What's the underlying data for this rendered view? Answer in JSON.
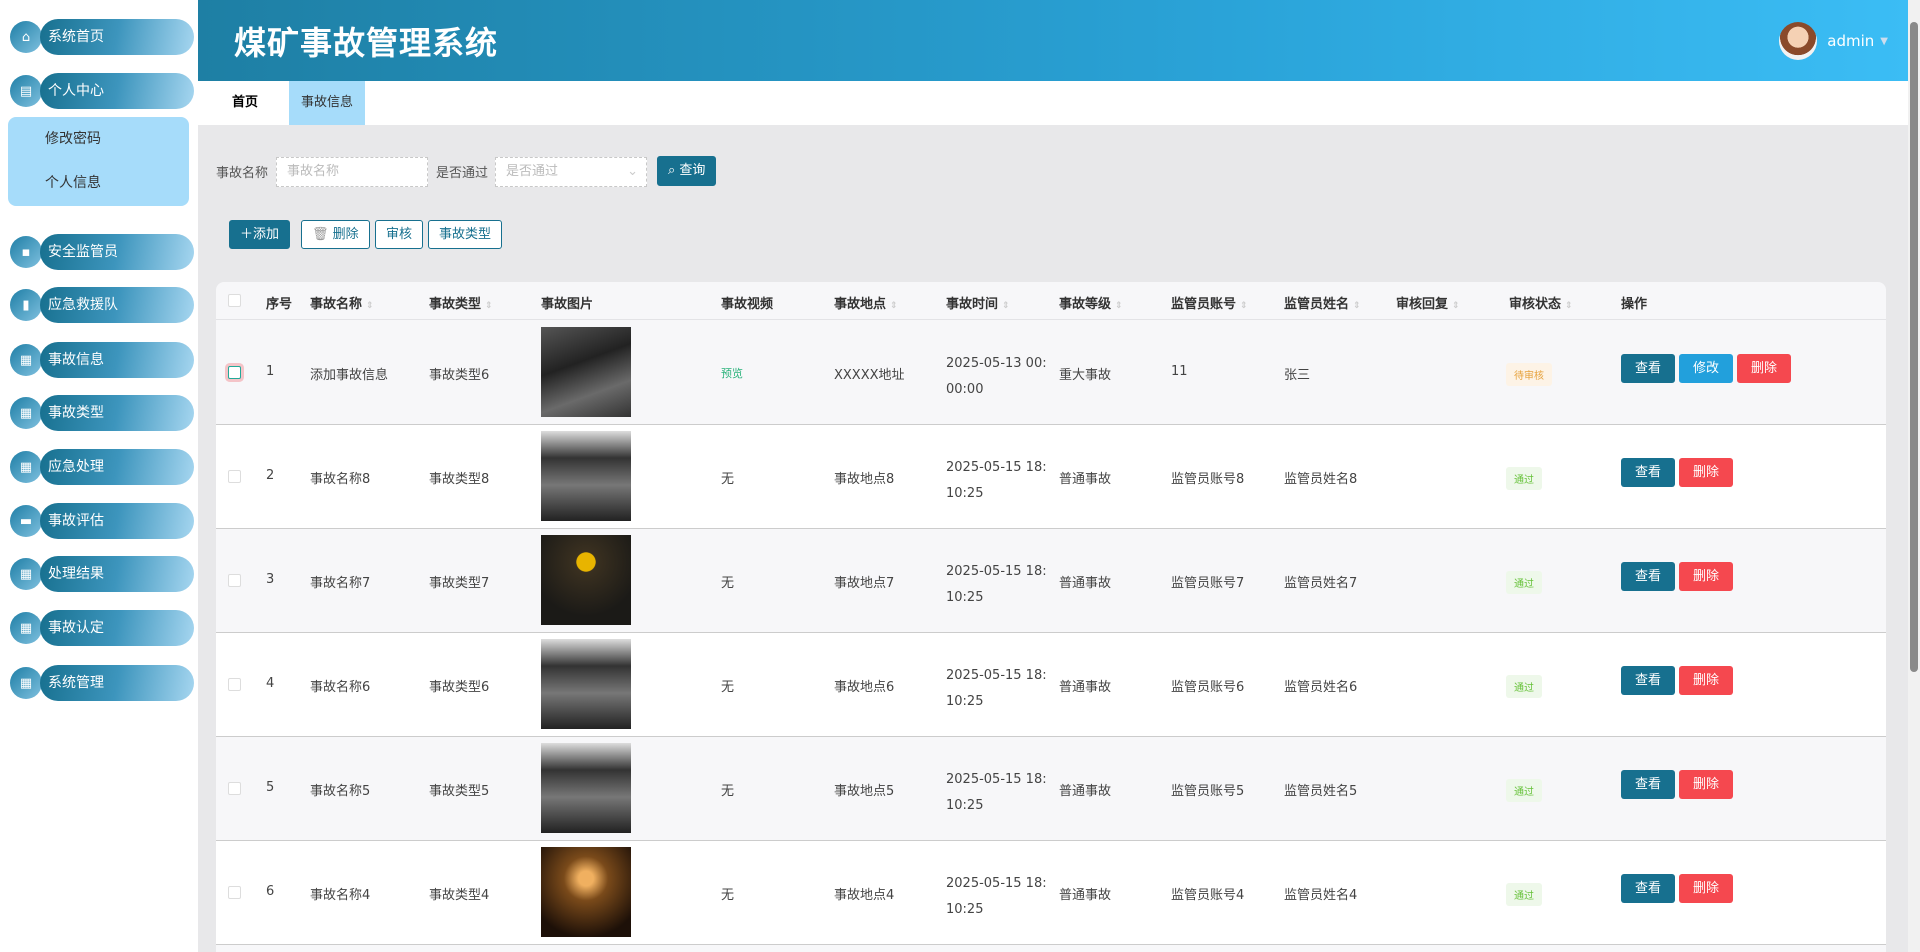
{
  "app_title": "煤矿事故管理系统",
  "user": {
    "name": "admin"
  },
  "sidebar": {
    "items": [
      "系统首页",
      "个人中心",
      "安全监管员",
      "应急救援队",
      "事故信息",
      "事故类型",
      "应急处理",
      "事故评估",
      "处理结果",
      "事故认定",
      "系统管理"
    ],
    "submenu": [
      "修改密码",
      "个人信息"
    ]
  },
  "tabs": [
    "首页",
    "事故信息"
  ],
  "search": {
    "name_label": "事故名称",
    "name_placeholder": "事故名称",
    "pass_label": "是否通过",
    "pass_placeholder": "是否通过",
    "query": "查询"
  },
  "toolbar": {
    "add": "添加",
    "delete": "删除",
    "audit": "审核",
    "type": "事故类型"
  },
  "columns": [
    "序号",
    "事故名称",
    "事故类型",
    "事故图片",
    "事故视频",
    "事故地点",
    "事故时间",
    "事故等级",
    "监管员账号",
    "监管员姓名",
    "审核回复",
    "审核状态",
    "操作"
  ],
  "rows": [
    {
      "no": "1",
      "name": "添加事故信息",
      "type": "事故类型6",
      "video": "预览",
      "place": "XXXXX地址",
      "time1": "2025-05-13 00:",
      "time2": "00:00",
      "level": "重大事故",
      "account": "11",
      "sname": "张三",
      "reply": "",
      "status": "待审核"
    },
    {
      "no": "2",
      "name": "事故名称8",
      "type": "事故类型8",
      "video": "无",
      "place": "事故地点8",
      "time1": "2025-05-15 18:",
      "time2": "10:25",
      "level": "普通事故",
      "account": "监管员账号8",
      "sname": "监管员姓名8",
      "reply": "",
      "status": "通过"
    },
    {
      "no": "3",
      "name": "事故名称7",
      "type": "事故类型7",
      "video": "无",
      "place": "事故地点7",
      "time1": "2025-05-15 18:",
      "time2": "10:25",
      "level": "普通事故",
      "account": "监管员账号7",
      "sname": "监管员姓名7",
      "reply": "",
      "status": "通过"
    },
    {
      "no": "4",
      "name": "事故名称6",
      "type": "事故类型6",
      "video": "无",
      "place": "事故地点6",
      "time1": "2025-05-15 18:",
      "time2": "10:25",
      "level": "普通事故",
      "account": "监管员账号6",
      "sname": "监管员姓名6",
      "reply": "",
      "status": "通过"
    },
    {
      "no": "5",
      "name": "事故名称5",
      "type": "事故类型5",
      "video": "无",
      "place": "事故地点5",
      "time1": "2025-05-15 18:",
      "time2": "10:25",
      "level": "普通事故",
      "account": "监管员账号5",
      "sname": "监管员姓名5",
      "reply": "",
      "status": "通过"
    },
    {
      "no": "6",
      "name": "事故名称4",
      "type": "事故类型4",
      "video": "无",
      "place": "事故地点4",
      "time1": "2025-05-15 18:",
      "time2": "10:25",
      "level": "普通事故",
      "account": "监管员账号4",
      "sname": "监管员姓名4",
      "reply": "",
      "status": "通过"
    }
  ],
  "actions": {
    "view": "查看",
    "edit": "修改",
    "delete": "删除"
  },
  "colors": {
    "primary": "#17708f",
    "edit": "#22a0dc",
    "danger": "#f5484f"
  }
}
